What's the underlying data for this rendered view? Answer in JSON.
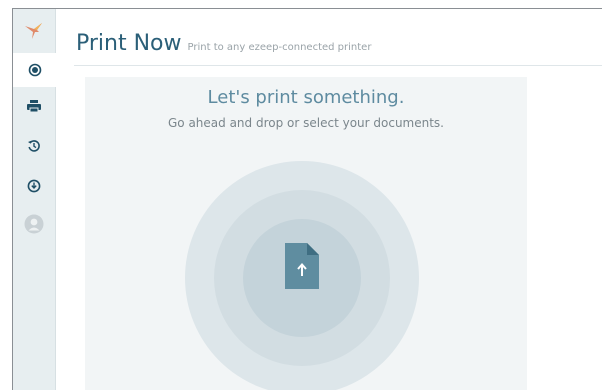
{
  "header": {
    "title": "Print Now",
    "subtitle": "Print to any ezeep-connected printer"
  },
  "sidebar": {
    "logo": "hummingbird-logo-icon",
    "items": [
      {
        "id": "print-now",
        "icon": "record-icon",
        "active": true
      },
      {
        "id": "printers",
        "icon": "printer-icon",
        "active": false
      },
      {
        "id": "history",
        "icon": "history-icon",
        "active": false
      },
      {
        "id": "downloads",
        "icon": "download-icon",
        "active": false
      },
      {
        "id": "account",
        "icon": "user-avatar-icon",
        "active": false
      }
    ]
  },
  "dropzone": {
    "headline": "Let's print something.",
    "instruction": "Go ahead and drop or select your documents.",
    "icon": "upload-document-icon"
  },
  "colors": {
    "sidebar_bg": "#e7eef0",
    "title": "#2b5f78",
    "icon": "#1f4f66",
    "headline": "#5e8ba0",
    "file_icon": "#5f8da0"
  }
}
